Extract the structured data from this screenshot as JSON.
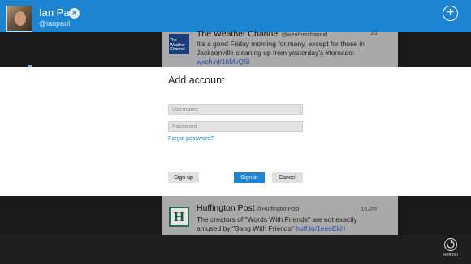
{
  "header": {
    "user_name": "Ian Paul",
    "user_handle": "@ianpaul",
    "remove_symbol": "×",
    "add_symbol": "+"
  },
  "feed": {
    "tweets": [
      {
        "author": "The Weather Channel",
        "handle": "@weatherchannel",
        "time": "2d",
        "logo_text": "The Weather Channel",
        "body": "It's a good Friday morning for many, except for those in Jacksonville cleaning up from yesterday's #tornado:",
        "link": "wxch.nl/16MvQSi"
      },
      {
        "author": "Huffington Post",
        "handle": "@HuffingtonPost",
        "time": "16.2m",
        "logo_text": "H",
        "body": "The creators of \"Words With Friends\" are not exactly amused by \"Bang With Friends\"",
        "link": "huff.to/1eeoEkH"
      }
    ]
  },
  "modal": {
    "title": "Add account",
    "username_placeholder": "Username",
    "password_placeholder": "Password",
    "forgot_label": "Forgot password?",
    "signup_label": "Sign up",
    "signin_label": "Sign in",
    "cancel_label": "Cancel"
  },
  "appbar": {
    "refresh_label": "Refresh"
  },
  "colors": {
    "accent": "#1c84d1",
    "dim_background": "#a9a9a9"
  },
  "icons": [
    "remove-account-icon",
    "add-icon",
    "refresh-icon"
  ]
}
